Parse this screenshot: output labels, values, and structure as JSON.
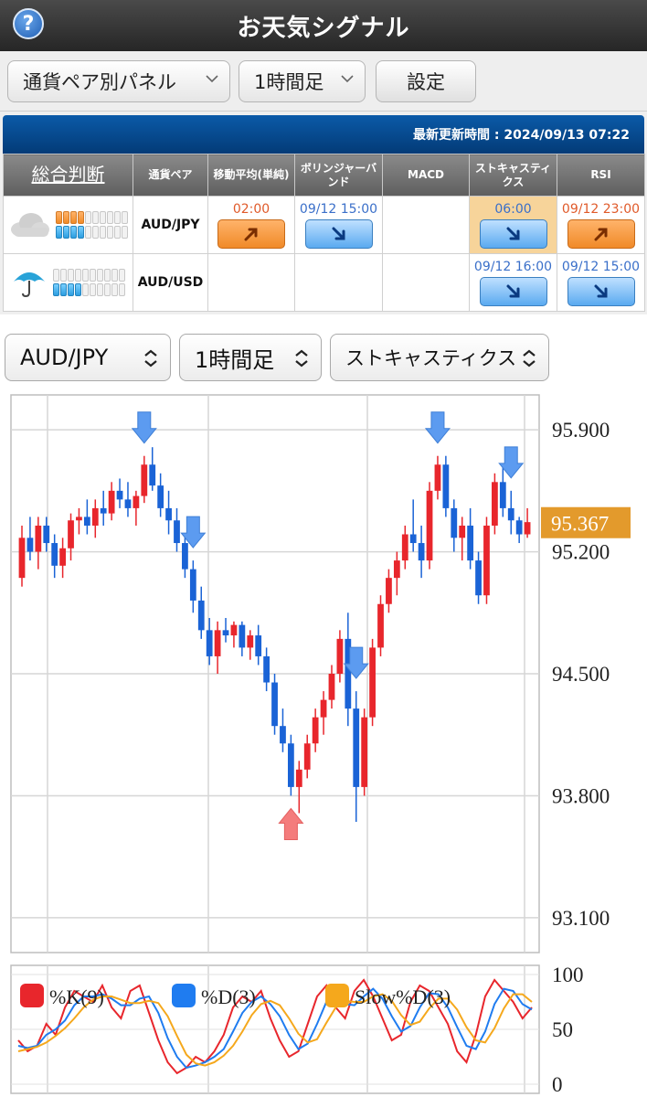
{
  "header": {
    "title": "お天気シグナル",
    "help_label": "?"
  },
  "toolbar": {
    "panel_select": "通貨ペア別パネル",
    "timeframe_select": "1時間足",
    "settings_label": "設定"
  },
  "panel": {
    "last_update": "最新更新時間 : 2024/09/13 07:22",
    "columns": [
      "総合判断",
      "通貨ペア",
      "移動平均(単純)",
      "ボリンジャーバンド",
      "MACD",
      "ストキャスティクス",
      "RSI"
    ],
    "rows": [
      {
        "pair": "AUD/JPY",
        "weather": "cloud-icon",
        "meter_top_orange": 4,
        "meter_bottom_blue": 4,
        "ma": {
          "time": "02:00",
          "dir": "up"
        },
        "bb": {
          "time": "09/12 15:00",
          "dir": "down"
        },
        "macd": null,
        "stoch": {
          "time": "06:00",
          "dir": "down",
          "highlight": true
        },
        "rsi": {
          "time": "09/12 23:00",
          "dir": "up"
        }
      },
      {
        "pair": "AUD/USD",
        "weather": "umbrella-icon",
        "meter_top_orange": 0,
        "meter_bottom_blue": 4,
        "ma": null,
        "bb": null,
        "macd": null,
        "stoch": {
          "time": "09/12 16:00",
          "dir": "down"
        },
        "rsi": {
          "time": "09/12 15:00",
          "dir": "down"
        }
      }
    ]
  },
  "chart_controls": {
    "pair": "AUD/JPY",
    "timeframe": "1時間足",
    "indicator": "ストキャスティクス"
  },
  "colors": {
    "up_candle": "#e8262c",
    "down_candle": "#1a63d6",
    "sell_arrow": "#5c9bf0",
    "buy_arrow": "#f47c7c",
    "price_tag": "#e39a2c",
    "k_line": "#e8262c",
    "d_line": "#1f7cf0",
    "slow_d_line": "#f5a81c"
  },
  "chart_data": [
    {
      "type": "candlestick",
      "title": "",
      "ylim": [
        92.9,
        96.1
      ],
      "yticks": [
        95.9,
        95.2,
        94.5,
        93.8,
        93.1
      ],
      "ytick_labels": [
        "95.900",
        "95.200",
        "94.500",
        "93.800",
        "93.100"
      ],
      "current_price": 95.367,
      "current_price_label": "95.367",
      "grid": true,
      "ohlc": [
        [
          95.05,
          95.35,
          95.0,
          95.28
        ],
        [
          95.28,
          95.4,
          95.15,
          95.2
        ],
        [
          95.2,
          95.4,
          95.1,
          95.35
        ],
        [
          95.35,
          95.4,
          95.2,
          95.25
        ],
        [
          95.25,
          95.3,
          95.05,
          95.12
        ],
        [
          95.12,
          95.28,
          95.05,
          95.22
        ],
        [
          95.22,
          95.42,
          95.15,
          95.38
        ],
        [
          95.38,
          95.45,
          95.3,
          95.4
        ],
        [
          95.4,
          95.5,
          95.3,
          95.35
        ],
        [
          95.35,
          95.5,
          95.28,
          95.45
        ],
        [
          95.45,
          95.55,
          95.35,
          95.42
        ],
        [
          95.42,
          95.6,
          95.38,
          95.55
        ],
        [
          95.55,
          95.62,
          95.45,
          95.5
        ],
        [
          95.5,
          95.6,
          95.4,
          95.45
        ],
        [
          95.45,
          95.55,
          95.35,
          95.52
        ],
        [
          95.52,
          95.75,
          95.48,
          95.7
        ],
        [
          95.7,
          95.8,
          95.55,
          95.58
        ],
        [
          95.58,
          95.65,
          95.4,
          95.45
        ],
        [
          95.45,
          95.55,
          95.3,
          95.38
        ],
        [
          95.38,
          95.45,
          95.2,
          95.25
        ],
        [
          95.25,
          95.3,
          95.05,
          95.1
        ],
        [
          95.1,
          95.15,
          94.85,
          94.92
        ],
        [
          94.92,
          95.0,
          94.7,
          94.75
        ],
        [
          94.75,
          94.82,
          94.55,
          94.6
        ],
        [
          94.6,
          94.8,
          94.5,
          94.75
        ],
        [
          94.75,
          94.82,
          94.68,
          94.72
        ],
        [
          94.72,
          94.8,
          94.65,
          94.78
        ],
        [
          94.78,
          94.8,
          94.6,
          94.65
        ],
        [
          94.65,
          94.75,
          94.58,
          94.72
        ],
        [
          94.72,
          94.78,
          94.55,
          94.6
        ],
        [
          94.6,
          94.65,
          94.4,
          94.45
        ],
        [
          94.45,
          94.5,
          94.15,
          94.2
        ],
        [
          94.2,
          94.3,
          94.05,
          94.1
        ],
        [
          94.1,
          94.15,
          93.8,
          93.85
        ],
        [
          93.85,
          94.0,
          93.7,
          93.95
        ],
        [
          93.95,
          94.15,
          93.9,
          94.1
        ],
        [
          94.1,
          94.3,
          94.05,
          94.25
        ],
        [
          94.25,
          94.4,
          94.15,
          94.35
        ],
        [
          94.35,
          94.55,
          94.3,
          94.5
        ],
        [
          94.5,
          94.75,
          94.45,
          94.7
        ],
        [
          94.7,
          94.85,
          94.2,
          94.3
        ],
        [
          94.3,
          94.4,
          93.65,
          93.85
        ],
        [
          93.85,
          94.3,
          93.8,
          94.25
        ],
        [
          94.25,
          94.7,
          94.2,
          94.65
        ],
        [
          94.65,
          94.95,
          94.6,
          94.9
        ],
        [
          94.9,
          95.1,
          94.85,
          95.05
        ],
        [
          95.05,
          95.2,
          94.95,
          95.15
        ],
        [
          95.15,
          95.35,
          95.1,
          95.3
        ],
        [
          95.3,
          95.5,
          95.2,
          95.25
        ],
        [
          95.25,
          95.35,
          95.05,
          95.15
        ],
        [
          95.15,
          95.6,
          95.1,
          95.55
        ],
        [
          95.55,
          95.75,
          95.5,
          95.7
        ],
        [
          95.7,
          95.75,
          95.4,
          95.45
        ],
        [
          95.45,
          95.5,
          95.2,
          95.28
        ],
        [
          95.28,
          95.4,
          95.15,
          95.35
        ],
        [
          95.35,
          95.45,
          95.1,
          95.15
        ],
        [
          95.15,
          95.2,
          94.9,
          94.95
        ],
        [
          94.95,
          95.4,
          94.9,
          95.35
        ],
        [
          95.35,
          95.65,
          95.3,
          95.6
        ],
        [
          95.6,
          95.7,
          95.4,
          95.45
        ],
        [
          95.45,
          95.55,
          95.3,
          95.38
        ],
        [
          95.38,
          95.4,
          95.25,
          95.3
        ],
        [
          95.3,
          95.45,
          95.28,
          95.37
        ]
      ],
      "signals": [
        {
          "index": 15,
          "side": "sell"
        },
        {
          "index": 21,
          "side": "sell"
        },
        {
          "index": 33,
          "side": "buy"
        },
        {
          "index": 41,
          "side": "sell"
        },
        {
          "index": 51,
          "side": "sell"
        },
        {
          "index": 60,
          "side": "sell"
        }
      ]
    },
    {
      "type": "line",
      "title": "",
      "ylim": [
        0,
        100
      ],
      "yticks": [
        100,
        50,
        0
      ],
      "ytick_labels": [
        "100",
        "50",
        "0"
      ],
      "series": [
        {
          "name": "%K(9)",
          "values": [
            40,
            30,
            35,
            55,
            45,
            70,
            85,
            80,
            75,
            90,
            70,
            60,
            85,
            90,
            65,
            40,
            20,
            10,
            15,
            25,
            20,
            30,
            45,
            70,
            80,
            75,
            85,
            60,
            40,
            25,
            30,
            55,
            80,
            90,
            70,
            60,
            85,
            95,
            80,
            60,
            40,
            45,
            75,
            90,
            85,
            70,
            55,
            30,
            20,
            45,
            80,
            95,
            85,
            75,
            60,
            70
          ]
        },
        {
          "name": "%D(3)",
          "values": [
            35,
            33,
            35,
            45,
            50,
            58,
            72,
            80,
            80,
            82,
            78,
            72,
            72,
            78,
            80,
            65,
            42,
            25,
            15,
            17,
            20,
            25,
            32,
            48,
            65,
            75,
            80,
            73,
            62,
            45,
            32,
            37,
            55,
            75,
            80,
            73,
            72,
            80,
            87,
            78,
            62,
            48,
            53,
            70,
            83,
            82,
            70,
            52,
            35,
            32,
            48,
            73,
            87,
            85,
            73,
            68
          ]
        },
        {
          "name": "Slow%D(3)",
          "values": [
            30,
            32,
            34,
            38,
            44,
            51,
            60,
            70,
            77,
            80,
            80,
            77,
            74,
            74,
            76,
            74,
            62,
            44,
            27,
            19,
            17,
            20,
            26,
            35,
            48,
            63,
            73,
            76,
            72,
            60,
            46,
            38,
            41,
            56,
            70,
            76,
            75,
            75,
            80,
            82,
            76,
            63,
            54,
            57,
            69,
            78,
            78,
            68,
            52,
            40,
            38,
            51,
            69,
            82,
            82,
            75
          ]
        }
      ]
    }
  ]
}
